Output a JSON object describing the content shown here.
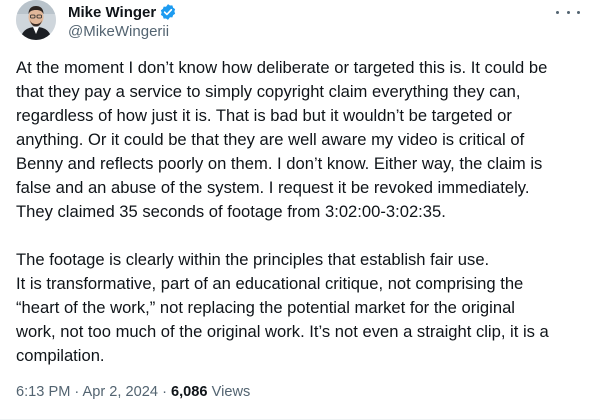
{
  "author": {
    "display_name": "Mike Winger",
    "handle": "@MikeWingerii",
    "verified": true,
    "verified_color": "#1d9bf0"
  },
  "tweet": {
    "paragraph1_lines": [
      "At the moment I don’t know how deliberate or targeted this is. It could be",
      "that they pay a service to simply copyright claim everything they can,",
      "regardless of how just it is. That is bad but it wouldn’t be targeted or",
      "anything. Or it could be that they are well aware my video is critical of",
      "Benny and reflects poorly on them. I don’t know. Either way, the claim is",
      "false and an abuse of the system. I request it be revoked immediately.",
      "They claimed 35 seconds of footage from 3:02:00-3:02:35."
    ],
    "paragraph2_lines": [
      "The footage is clearly within the principles that establish fair use.",
      "It is transformative, part of an educational critique, not comprising the",
      "“heart of the work,” not replacing the potential market for the original",
      "work, not too much of the original work. It’s not even a straight clip, it is a",
      "compilation."
    ]
  },
  "meta": {
    "time": "6:13 PM",
    "separator": "·",
    "date": "Apr 2, 2024",
    "views_count": "6,086",
    "views_label": "Views"
  },
  "icons": {
    "verified": "verified-badge-icon",
    "more": "more-options-icon"
  }
}
